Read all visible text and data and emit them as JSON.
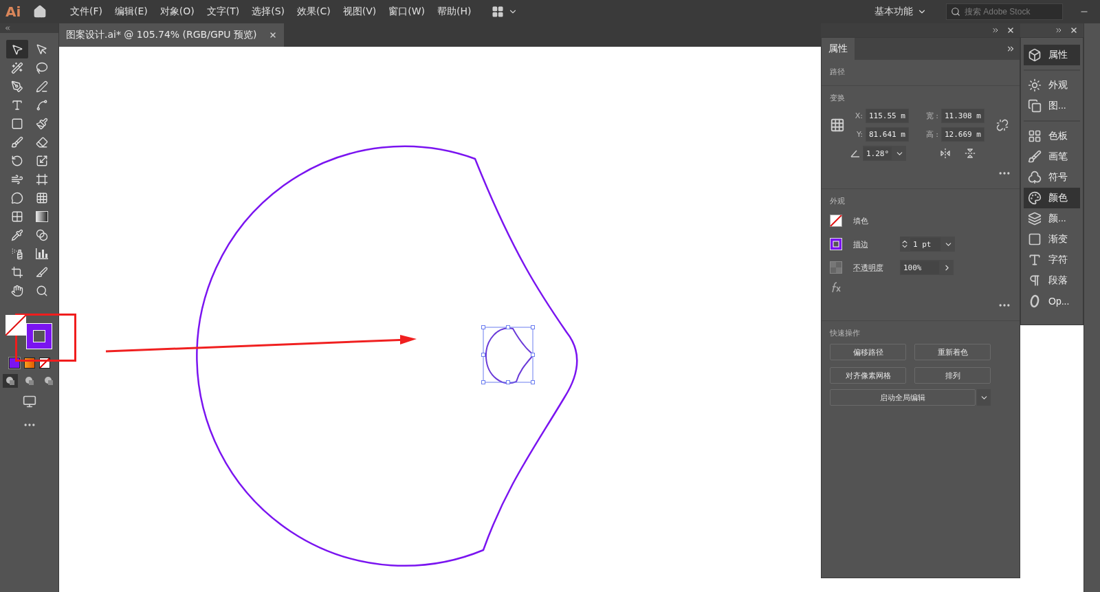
{
  "app_logo": "Ai",
  "menu": [
    "文件(F)",
    "编辑(E)",
    "对象(O)",
    "文字(T)",
    "选择(S)",
    "效果(C)",
    "视图(V)",
    "窗口(W)",
    "帮助(H)"
  ],
  "workspace": {
    "label": "基本功能"
  },
  "search": {
    "placeholder": "搜索 Adobe Stock"
  },
  "document_tab": {
    "title": "图案设计.ai* @ 105.74% (RGB/GPU 预览)",
    "selected": true
  },
  "tools": [
    {
      "kind": "selection",
      "selected": true
    },
    {
      "kind": "direct-selection",
      "selected": false
    },
    {
      "kind": "magic-wand",
      "selected": false
    },
    {
      "kind": "lasso",
      "selected": false
    },
    {
      "kind": "pen",
      "selected": false
    },
    {
      "kind": "curvature",
      "selected": false
    },
    {
      "kind": "type",
      "selected": false
    },
    {
      "kind": "arc",
      "selected": false
    },
    {
      "kind": "rectangle",
      "selected": false
    },
    {
      "kind": "paintbrush",
      "selected": false
    },
    {
      "kind": "shaper",
      "selected": false
    },
    {
      "kind": "eraser",
      "selected": false
    },
    {
      "kind": "rotate",
      "selected": false
    },
    {
      "kind": "scale",
      "selected": false
    },
    {
      "kind": "warp",
      "selected": false
    },
    {
      "kind": "free-transform",
      "selected": false
    },
    {
      "kind": "shape-builder",
      "selected": false
    },
    {
      "kind": "perspective",
      "selected": false
    },
    {
      "kind": "mesh",
      "selected": false
    },
    {
      "kind": "gradient",
      "selected": false
    },
    {
      "kind": "eyedropper",
      "selected": false
    },
    {
      "kind": "blend",
      "selected": false
    },
    {
      "kind": "symbol-sprayer",
      "selected": false
    },
    {
      "kind": "graph",
      "selected": false
    },
    {
      "kind": "artboard",
      "selected": false
    },
    {
      "kind": "slice",
      "selected": false
    },
    {
      "kind": "hand",
      "selected": false
    },
    {
      "kind": "zoom",
      "selected": false
    }
  ],
  "draw_modes": [
    {
      "selected": true
    },
    {
      "selected": false
    },
    {
      "selected": false
    }
  ],
  "properties": {
    "tab": "属性",
    "object_type": "路径",
    "transform": {
      "title": "变换",
      "x_label": "X:",
      "x": "115.55 m",
      "y_label": "Y:",
      "y": "81.641 m",
      "w_label": "宽 :",
      "w": "11.308 m",
      "h_label": "高 :",
      "h": "12.669 m",
      "angle": "1.28°"
    },
    "appearance": {
      "title": "外观",
      "rows": [
        {
          "kind": "fill",
          "label": "填色"
        },
        {
          "kind": "stroke",
          "label": "描边",
          "value": "1 pt"
        },
        {
          "kind": "opacity",
          "label": "不透明度",
          "value": "100%"
        }
      ]
    },
    "quick_actions": {
      "title": "快速操作",
      "buttons": [
        "偏移路径",
        "重新着色",
        "对齐像素网格",
        "排列"
      ],
      "global_edit": "启动全局编辑"
    }
  },
  "dock": {
    "groups": [
      {
        "items": [
          {
            "kind": "properties",
            "label": "属性",
            "selected": true
          }
        ]
      },
      {
        "items": [
          {
            "kind": "appearance",
            "label": "外观",
            "selected": false
          },
          {
            "kind": "graphic-styles",
            "label": "图...",
            "selected": false
          }
        ]
      },
      {
        "items": [
          {
            "kind": "swatches",
            "label": "色板",
            "selected": false
          },
          {
            "kind": "brushes",
            "label": "画笔",
            "selected": false
          },
          {
            "kind": "symbols",
            "label": "符号",
            "selected": false
          },
          {
            "kind": "color",
            "label": "颜色",
            "selected": true
          },
          {
            "kind": "color-guide",
            "label": "颜...",
            "selected": false
          },
          {
            "kind": "gradient",
            "label": "渐变",
            "selected": false
          },
          {
            "kind": "character",
            "label": "字符",
            "selected": false
          },
          {
            "kind": "paragraph",
            "label": "段落",
            "selected": false
          },
          {
            "kind": "opentype",
            "label": "Op...",
            "selected": false
          }
        ]
      }
    ]
  }
}
